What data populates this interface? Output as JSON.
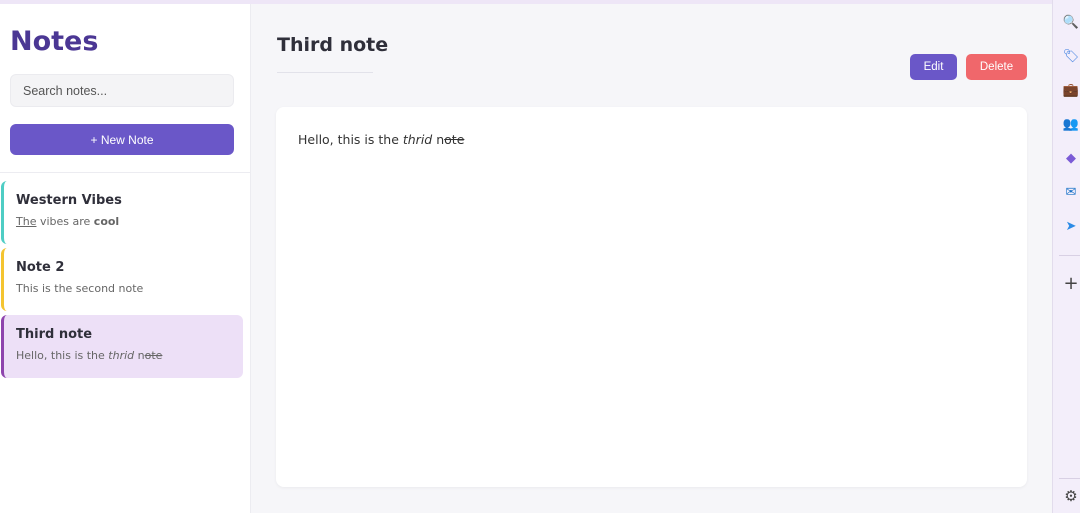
{
  "sidebar": {
    "title": "Notes",
    "search_placeholder": "Search notes...",
    "new_note_label": "+ New Note",
    "notes": [
      {
        "title": "Western Vibes",
        "accent": "#4ecdc4",
        "preview": [
          {
            "text": "The",
            "style": "u"
          },
          {
            "text": " vibes are ",
            "style": ""
          },
          {
            "text": "cool",
            "style": "b"
          }
        ]
      },
      {
        "title": "Note 2",
        "accent": "#f4c430",
        "preview": [
          {
            "text": "This is the second note",
            "style": ""
          }
        ]
      },
      {
        "title": "Third note",
        "accent": "#8e44ad",
        "preview": [
          {
            "text": "Hello, this is the ",
            "style": ""
          },
          {
            "text": "thrid",
            "style": "i"
          },
          {
            "text": " n",
            "style": ""
          },
          {
            "text": "ote",
            "style": "s"
          }
        ]
      }
    ]
  },
  "main": {
    "title": "Third note",
    "edit_label": "Edit",
    "delete_label": "Delete",
    "content": [
      {
        "text": "Hello, this is the ",
        "style": ""
      },
      {
        "text": "thrid",
        "style": "i"
      },
      {
        "text": " n",
        "style": ""
      },
      {
        "text": "ote",
        "style": "s"
      }
    ]
  },
  "right_rail": {
    "icons": [
      {
        "name": "search-icon",
        "glyph": "🔍"
      },
      {
        "name": "tag-icon",
        "glyph": "🏷"
      },
      {
        "name": "briefcase-icon",
        "glyph": "💼"
      },
      {
        "name": "people-icon",
        "glyph": "👥"
      },
      {
        "name": "copilot-icon",
        "glyph": "◆"
      },
      {
        "name": "outlook-icon",
        "glyph": "✉"
      },
      {
        "name": "send-icon",
        "glyph": "➤"
      }
    ],
    "add_glyph": "+",
    "settings_glyph": "⚙"
  },
  "colors": {
    "accent": "#6a57c8",
    "danger": "#f0676b",
    "title": "#4b3794",
    "active_note_bg": "#ede0f7"
  }
}
